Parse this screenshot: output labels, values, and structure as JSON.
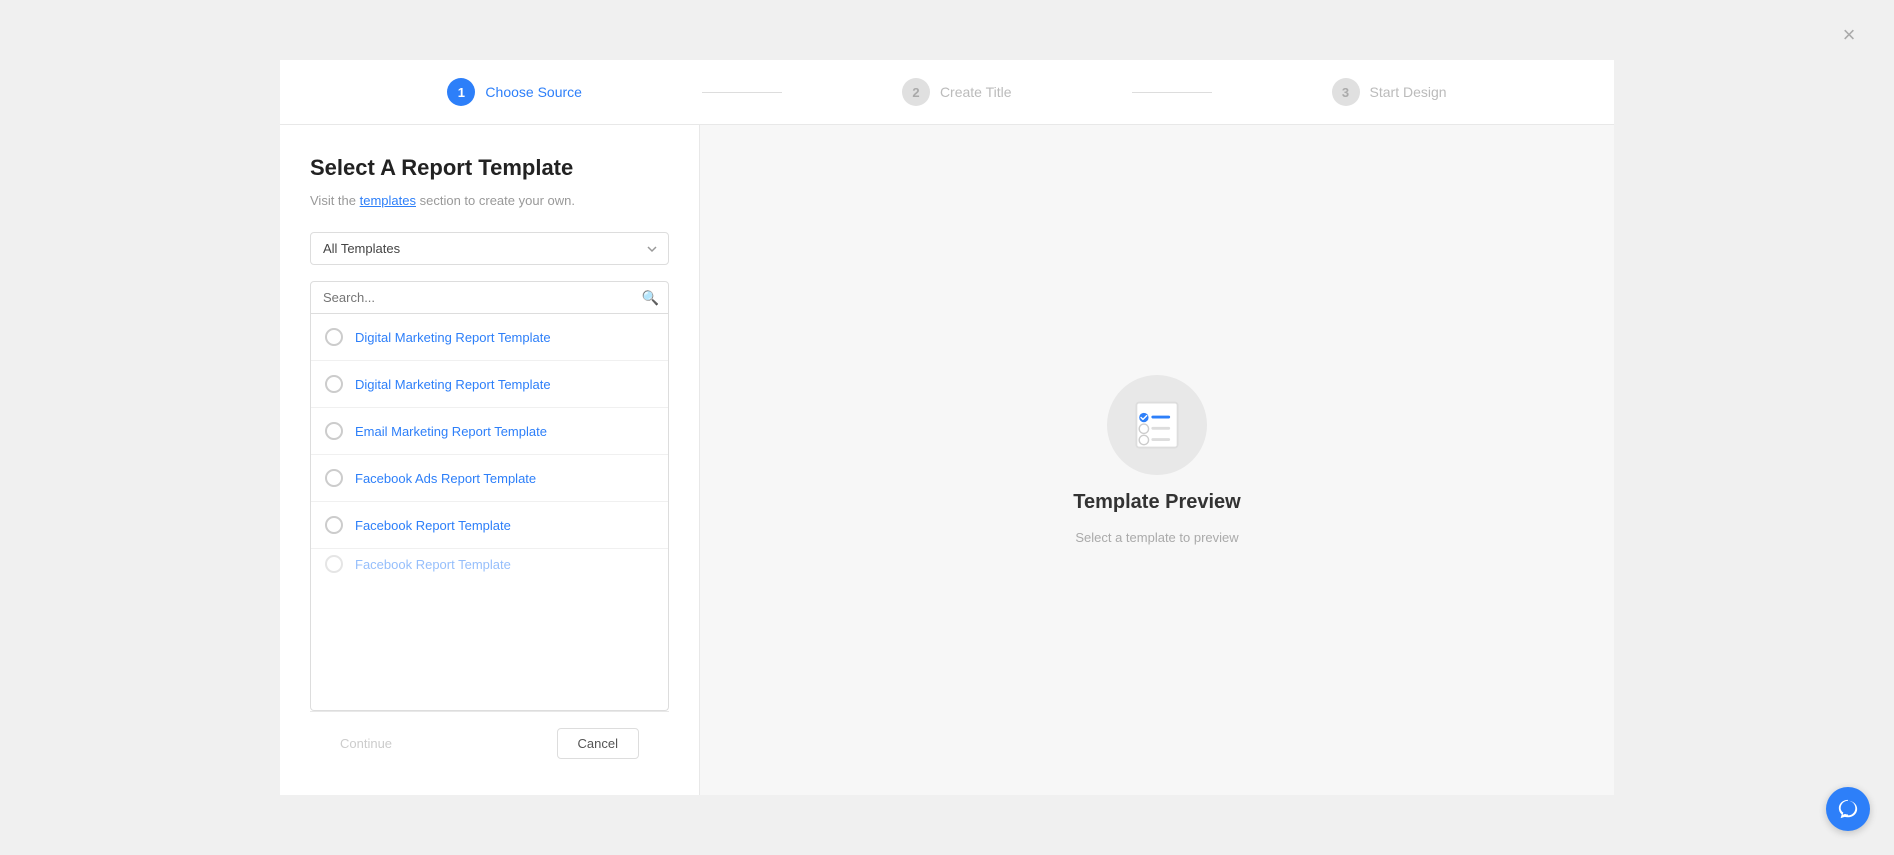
{
  "close_button": "×",
  "stepper": {
    "step1": {
      "number": "1",
      "label": "Choose Source",
      "active": true
    },
    "step2": {
      "number": "2",
      "label": "Create Title",
      "active": false
    },
    "step3": {
      "number": "3",
      "label": "Start Design",
      "active": false
    }
  },
  "left_panel": {
    "title": "Select A Report Template",
    "subtitle_prefix": "Visit the ",
    "subtitle_link": "templates",
    "subtitle_suffix": " section to create your own.",
    "dropdown_value": "All Templates",
    "search_placeholder": "Search...",
    "template_items": [
      {
        "id": 1,
        "label": "Digital Marketing Report Template"
      },
      {
        "id": 2,
        "label": "Digital Marketing Report Template"
      },
      {
        "id": 3,
        "label": "Email Marketing Report Template"
      },
      {
        "id": 4,
        "label": "Facebook Ads Report Template"
      },
      {
        "id": 5,
        "label": "Facebook Report Template"
      },
      {
        "id": 6,
        "label": "Facebook Report Template"
      }
    ]
  },
  "footer": {
    "continue_label": "Continue",
    "cancel_label": "Cancel"
  },
  "right_panel": {
    "title": "Template Preview",
    "subtitle": "Select a template to preview"
  }
}
